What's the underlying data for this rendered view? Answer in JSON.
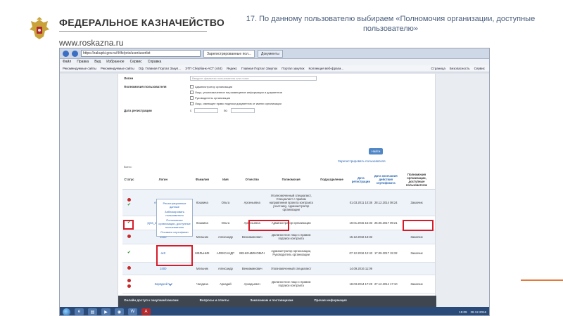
{
  "slide": {
    "brand_title": "ФЕДЕРАЛЬНОЕ КАЗНАЧЕЙСТВО",
    "brand_url": "www.roskazna.ru",
    "caption": "17. По данному пользователю выбираем «Полномочия организации, доступные пользователю»",
    "colors": {
      "accent": "#e07b3c",
      "caption": "#4a5f7e",
      "highlight": "#d81b2a"
    }
  },
  "browser": {
    "url": "https://zakupki.gov.ru/44fz/priz/user/userlist",
    "tabs": [
      "Зарегистрированные пол...",
      "Документы"
    ],
    "menu": [
      "Файл",
      "Правка",
      "Вид",
      "Избранное",
      "Сервис",
      "Справка"
    ],
    "favorites": [
      "Рекомендуемые сайты",
      "Рекомендуемые сайты",
      "Оф. Главная Портал Закуп...",
      "ЭТП Сбербанк-АСТ (444)",
      "Яндекс",
      "Главная Портал Закупок",
      "Портал закупок",
      "Коллекция веб-фрагм..."
    ],
    "favorites_right": [
      "Страница",
      "Безопасность",
      "Сервис"
    ]
  },
  "form": {
    "login_label": "Логин",
    "login_placeholder": "Введите фамилию пользователя или логин",
    "powers_label": "Полномочия пользователя",
    "powers": [
      "Администратор организации",
      "Лицо, уполномоченное на размещение информации и документов",
      "Руководитель организации",
      "Лицо, имеющее право подписи документов от имени организации"
    ],
    "date_label": "Дата регистрации",
    "date_from": "с",
    "date_to": "по",
    "find_button": "Найти",
    "register_link": "Зарегистрировать пользователя",
    "found_text": "Всего:"
  },
  "table": {
    "headers": [
      "Статус",
      "Логин",
      "Фамилия",
      "Имя",
      "Отчество",
      "Полномочия",
      "Подразделение",
      "Дата регистрации",
      "Дата окончания действия сертификата",
      "Полномочия организации, доступные пользователю"
    ],
    "rows": [
      {
        "status": "red-green",
        "login": "ekolyrazm",
        "last": "Кошкина",
        "first": "Ольга",
        "middle": "Арсеньевна",
        "powers": "Уполномоченный специалист, Специалист с правом направления проекта контракта участнику, Администратор организации",
        "dept": "",
        "reg": "01.03.2011 10:38",
        "cert": "28.12.2014 08:24",
        "org": "Заказчик"
      },
      {
        "status": "green",
        "login": "pyra_od-to-ecumoeb",
        "last": "Кошкина",
        "first": "Ольга",
        "middle": "Арсеньевна",
        "powers": "Администратор организации",
        "dept": "",
        "reg": "19.01.2015 15:33",
        "cert": "25.06.2017 09:21",
        "org": ""
      },
      {
        "status": "red-green",
        "login": "2400",
        "last": "Мельник",
        "first": "Александр",
        "middle": "Вениаминович",
        "powers": "Должностное лицо с правом подписи контракта",
        "dept": "",
        "reg": "15.12.2016 13:32",
        "cert": "",
        "org": "Заказчик"
      },
      {
        "status": "green",
        "login": "ac0",
        "last": "МЕЛЬНИК",
        "first": "АЛЕКСАНДР",
        "middle": "ВЕНИАМИНОВИЧ",
        "powers": "Администратор организации, Руководитель организации",
        "dept": "",
        "reg": "07.12.2016 12:43",
        "cert": "17.09.2017 15:32",
        "org": "Заказчик"
      },
      {
        "status": "red",
        "login": "2400",
        "last": "Мельник",
        "first": "Александр",
        "middle": "Вениаминович",
        "powers": "Уполномоченный специалист",
        "dept": "",
        "reg": "14.09.2016 11:09",
        "cert": "",
        "org": ""
      },
      {
        "status": "red-red",
        "login": "Зарядкой",
        "last": "Чалдина",
        "first": "Аркадий",
        "middle": "Аркадьевич",
        "powers": "Должностное лицо с правом подписи контракта",
        "dept": "",
        "reg": "18.03.2014 17:20",
        "cert": "27.12.2014 17:10",
        "org": "Заказчик"
      }
    ]
  },
  "popup": {
    "items": [
      "Регистрационные данные",
      "Заблокировать пользователя",
      "Полномочия организации, доступные пользователю",
      "Отозвать сертификат"
    ]
  },
  "site_footer": [
    "Онлайн доступ к закупкам/заказам",
    "Вопросы и ответы",
    "Заказчикам и поставщикам",
    "Прочая информация"
  ],
  "taskbar": {
    "clock_time": "15:09",
    "clock_date": "28.12.2016"
  }
}
